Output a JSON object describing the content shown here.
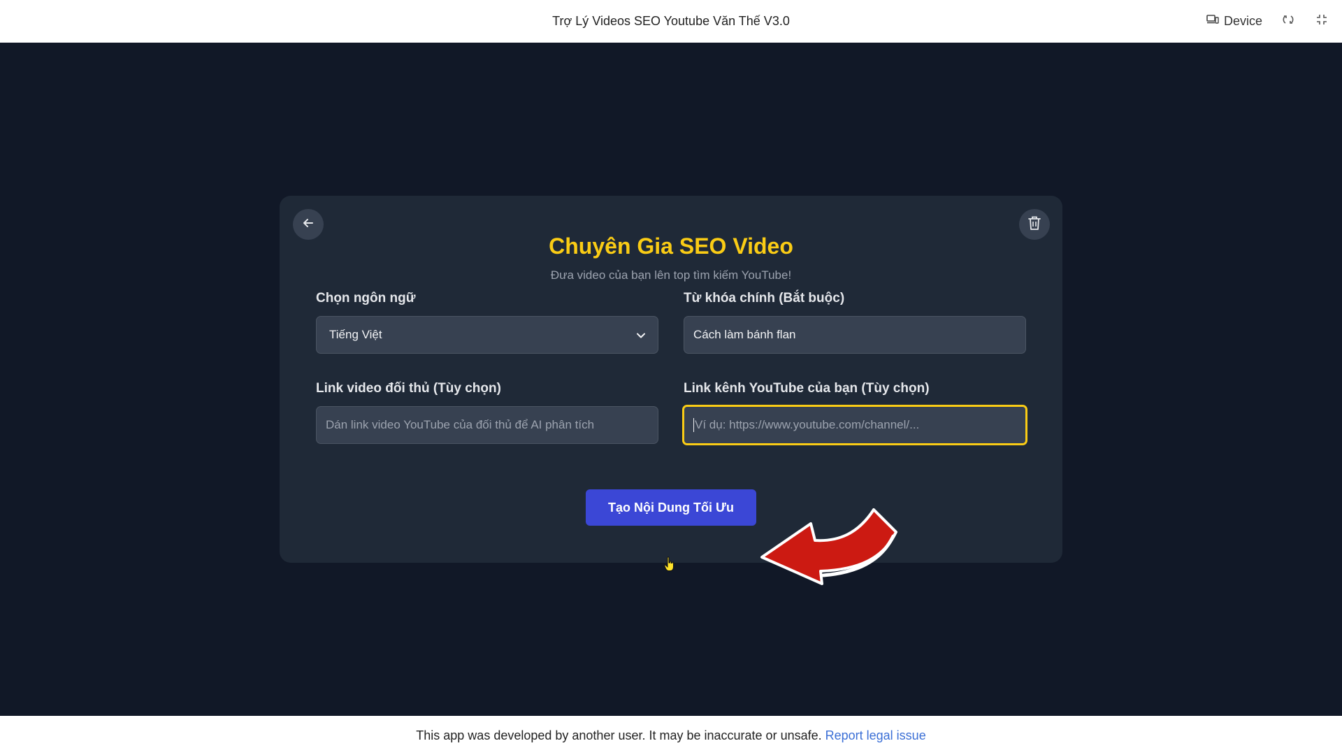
{
  "topbar": {
    "title": "Trợ Lý Videos SEO Youtube Văn Thế V3.0",
    "device_label": "Device"
  },
  "card": {
    "title": "Chuyên Gia SEO Video",
    "subtitle": "Đưa video của bạn lên top tìm kiếm YouTube!",
    "language": {
      "label": "Chọn ngôn ngữ",
      "selected": "Tiếng Việt"
    },
    "keyword": {
      "label": "Từ khóa chính (Bắt buộc)",
      "value": "Cách làm bánh flan"
    },
    "competitor_link": {
      "label": "Link video đối thủ (Tùy chọn)",
      "placeholder": "Dán link video YouTube của đối thủ để AI phân tích"
    },
    "channel_link": {
      "label": "Link kênh YouTube của bạn (Tùy chọn)",
      "placeholder": "Ví dụ: https://www.youtube.com/channel/..."
    },
    "submit_label": "Tạo Nội Dung Tối Ưu"
  },
  "footer": {
    "notice": "This app was developed by another user. It may be inaccurate or unsafe.",
    "link_label": "Report legal issue"
  },
  "colors": {
    "accent_yellow": "#facc15",
    "button_blue": "#3b47d6",
    "card_bg": "#1f2937",
    "page_bg": "#111827",
    "annotation_red": "#cc1a12"
  },
  "icons": [
    "device-icon",
    "refresh-icon",
    "fullscreen-icon",
    "back-arrow-icon",
    "trash-icon",
    "chevron-down-icon",
    "red-arrow-annotation",
    "hand-cursor-icon"
  ]
}
